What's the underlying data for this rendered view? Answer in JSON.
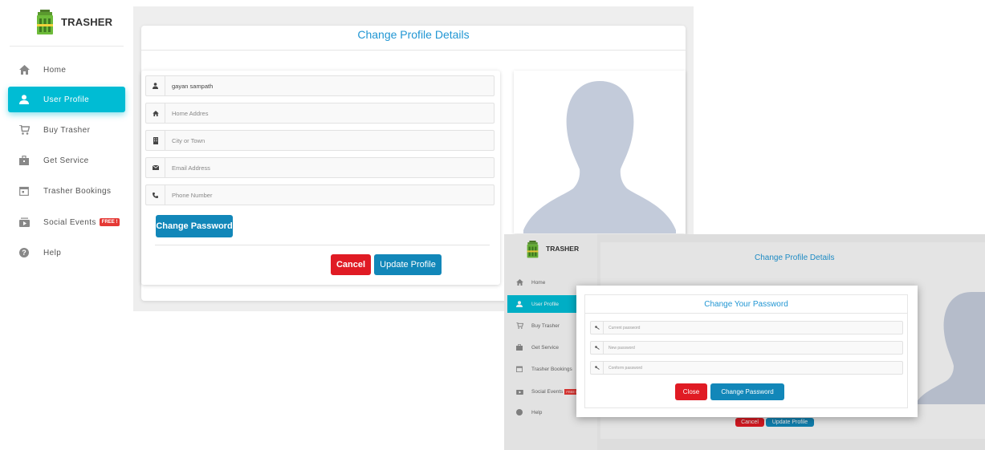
{
  "app": {
    "logo_text": "TRASHER"
  },
  "sidebar": {
    "items": [
      {
        "label": "Home",
        "icon": "home-icon"
      },
      {
        "label": "User Profile",
        "icon": "person-icon",
        "active": true
      },
      {
        "label": "Buy Trasher",
        "icon": "cart-icon"
      },
      {
        "label": "Get Service",
        "icon": "briefcase-icon"
      },
      {
        "label": "Trasher Bookings",
        "icon": "calendar-icon"
      },
      {
        "label": "Social Events",
        "icon": "events-icon",
        "badge": "FREE !"
      },
      {
        "label": "Help",
        "icon": "help-icon"
      }
    ]
  },
  "profile": {
    "title": "Change Profile Details",
    "fields": {
      "name_value": "gayan sampath",
      "address_placeholder": "Home Addres",
      "city_placeholder": "City or Town",
      "email_placeholder": "Email Address",
      "phone_placeholder": "Phone Number"
    },
    "change_password_label": "Change Password",
    "cancel_label": "Cancel",
    "update_label": "Update Profile"
  },
  "modal": {
    "title": "Change Your Password",
    "current_placeholder": "Current password",
    "new_placeholder": "New password",
    "confirm_placeholder": "Conform password",
    "close_label": "Close",
    "submit_label": "Change Password"
  },
  "colors": {
    "accent": "#00bcd4",
    "title_blue": "#2196d3",
    "button_blue": "#1287b9",
    "button_red": "#e01b24",
    "avatar_silhouette": "#c3cbda"
  }
}
